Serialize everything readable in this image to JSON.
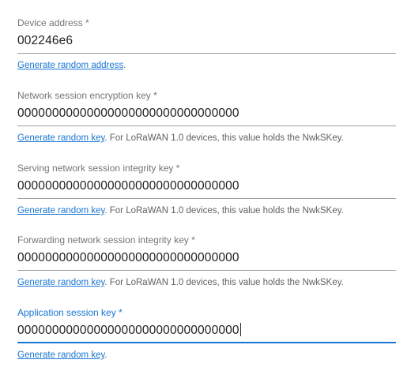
{
  "fields": [
    {
      "label": "Device address *",
      "value": "002246e6",
      "link": "Generate random address",
      "suffix": "."
    },
    {
      "label": "Network session encryption key *",
      "value": "00000000000000000000000000000000",
      "link": "Generate random key",
      "suffix": ". For LoRaWAN 1.0 devices, this value holds the NwkSKey."
    },
    {
      "label": "Serving network session integrity key *",
      "value": "00000000000000000000000000000000",
      "link": "Generate random key",
      "suffix": ". For LoRaWAN 1.0 devices, this value holds the NwkSKey."
    },
    {
      "label": "Forwarding network session integrity key *",
      "value": "00000000000000000000000000000000",
      "link": "Generate random key",
      "suffix": ". For LoRaWAN 1.0 devices, this value holds the NwkSKey."
    },
    {
      "label": "Application session key *",
      "value": "00000000000000000000000000000000",
      "link": "Generate random key",
      "suffix": ".",
      "focused": true
    }
  ],
  "colors": {
    "accent": "#1976d2",
    "label": "#757575",
    "text": "#212121",
    "underline": "#9e9e9e"
  }
}
